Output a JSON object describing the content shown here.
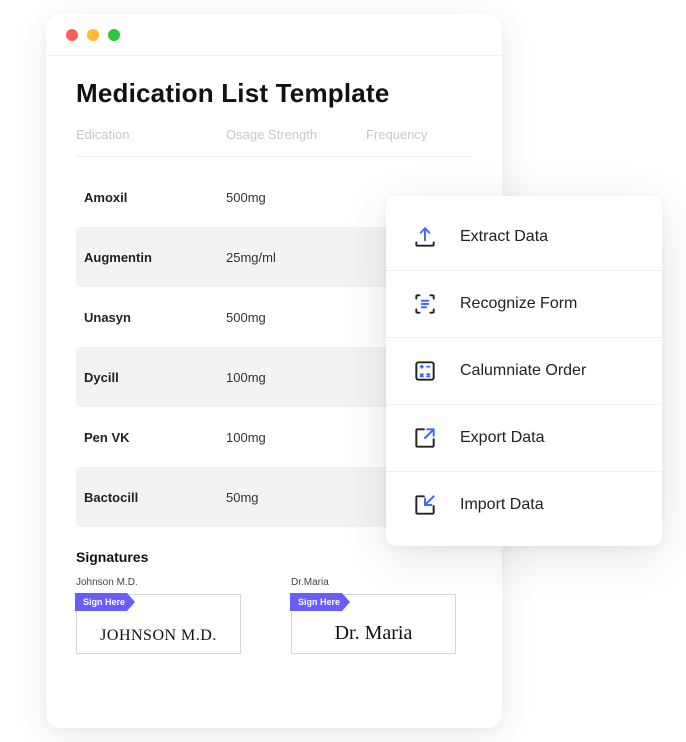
{
  "window": {
    "title": "Medication List Template",
    "columns": {
      "c1": "Edication",
      "c2": "Osage Strength",
      "c3": "Frequency"
    },
    "rows": [
      {
        "name": "Amoxil",
        "strength": "500mg"
      },
      {
        "name": "Augmentin",
        "strength": "25mg/ml"
      },
      {
        "name": "Unasyn",
        "strength": "500mg"
      },
      {
        "name": "Dycill",
        "strength": "100mg"
      },
      {
        "name": "Pen VK",
        "strength": "100mg"
      },
      {
        "name": "Bactocill",
        "strength": "50mg"
      }
    ],
    "signatures": {
      "heading": "Signatures",
      "sign_here": "Sign Here",
      "items": [
        {
          "label": "Johnson M.D.",
          "value": "JOHNSON M.D."
        },
        {
          "label": "Dr.Maria",
          "value": "Dr. Maria"
        }
      ]
    }
  },
  "menu": {
    "items": [
      {
        "label": "Extract Data"
      },
      {
        "label": "Recognize Form"
      },
      {
        "label": "Calumniate Order"
      },
      {
        "label": "Export Data"
      },
      {
        "label": "Import Data"
      }
    ]
  },
  "colors": {
    "accent": "#3b66ff",
    "tag": "#6b5cff"
  }
}
